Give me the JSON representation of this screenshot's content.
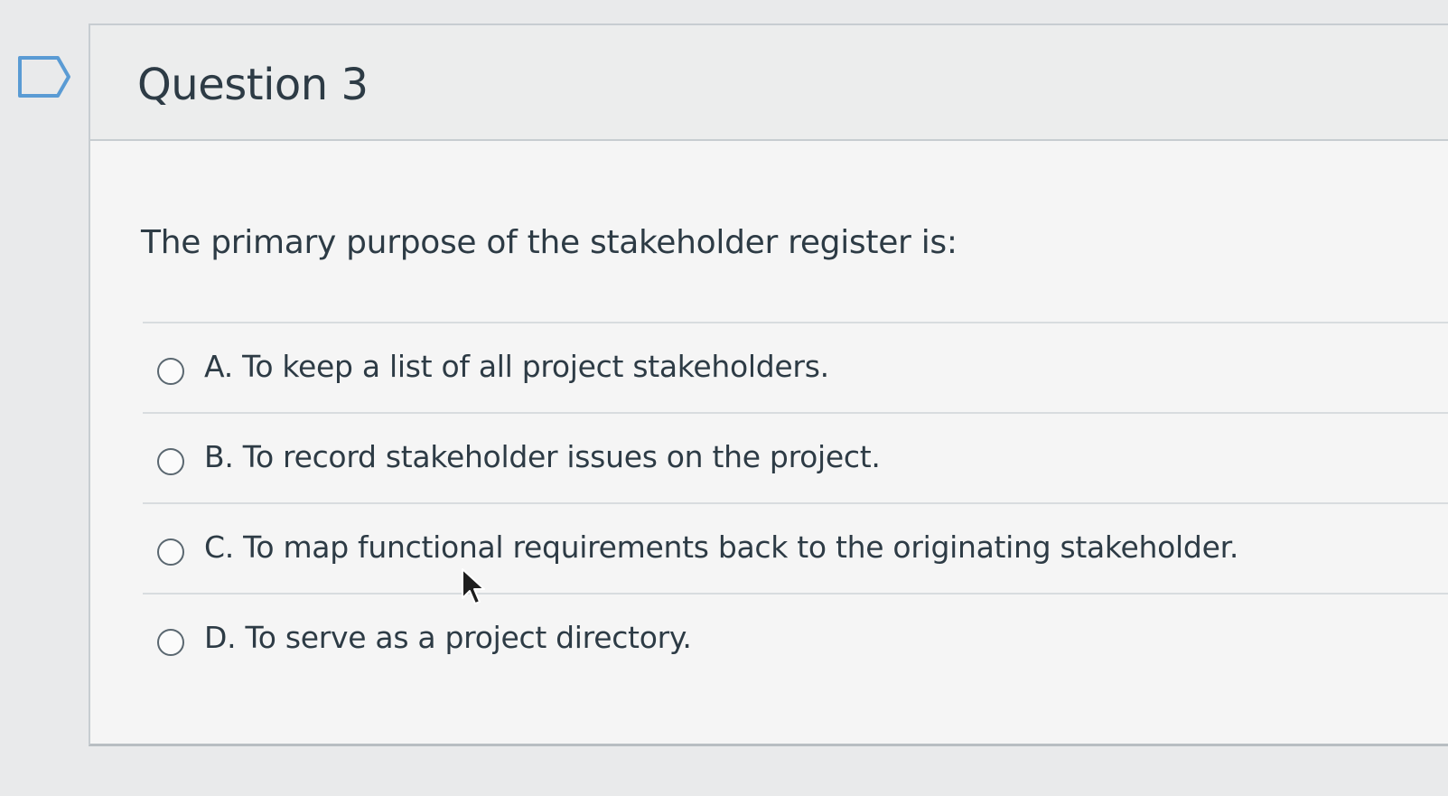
{
  "question": {
    "title": "Question 3",
    "text": "The primary purpose of the stakeholder register is:",
    "answers": [
      {
        "label": "A. To keep a list of all project stakeholders.",
        "selected": false
      },
      {
        "label": "B. To record stakeholder issues on the project.",
        "selected": false
      },
      {
        "label": "C. To map functional requirements back to the originating stakeholder.",
        "selected": false
      },
      {
        "label": "D. To serve as a project directory.",
        "selected": false
      }
    ]
  },
  "icons": {
    "flag": "flag-outline-icon",
    "cursor": "mouse-pointer-icon"
  },
  "colors": {
    "text": "#2d3b45",
    "border": "#c7cdd1"
  }
}
